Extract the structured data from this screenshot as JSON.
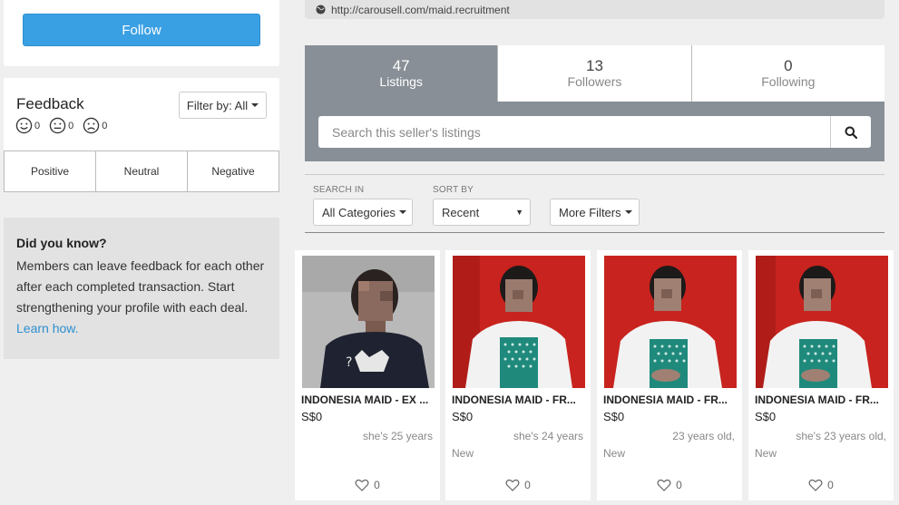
{
  "profile": {
    "follow_label": "Follow"
  },
  "feedback": {
    "title": "Feedback",
    "filter_label": "Filter by: All",
    "counts": {
      "positive": "0",
      "neutral": "0",
      "negative": "0"
    },
    "tabs": [
      "Positive",
      "Neutral",
      "Negative"
    ]
  },
  "did_you_know": {
    "title": "Did you know?",
    "text": "Members can leave feedback for each other after each completed transaction. Start strengthening your profile with each deal.",
    "link": "Learn how."
  },
  "url": "http://carousell.com/maid.recruitment",
  "stats": [
    {
      "num": "47",
      "label": "Listings"
    },
    {
      "num": "13",
      "label": "Followers"
    },
    {
      "num": "0",
      "label": "Following"
    }
  ],
  "search": {
    "placeholder": "Search this seller's listings"
  },
  "filters": {
    "search_in_label": "SEARCH IN",
    "search_in_value": "All Categories",
    "sort_by_label": "SORT BY",
    "sort_by_value": "Recent",
    "more_filters": "More Filters"
  },
  "listings": [
    {
      "title": "INDONESIA MAID - EX ...",
      "price": "S$0",
      "desc": "she's 25 years",
      "condition": "",
      "likes": "0",
      "background": "#b8b8b8"
    },
    {
      "title": "INDONESIA MAID - FR...",
      "price": "S$0",
      "desc": "she's 24 years",
      "condition": "New",
      "likes": "0",
      "background": "#c8231e"
    },
    {
      "title": "INDONESIA MAID - FR...",
      "price": "S$0",
      "desc": "23 years old,",
      "condition": "New",
      "likes": "0",
      "background": "#c8231e"
    },
    {
      "title": "INDONESIA MAID - FR...",
      "price": "S$0",
      "desc": "she's 23 years old,",
      "condition": "New",
      "likes": "0",
      "background": "#c8231e"
    }
  ]
}
